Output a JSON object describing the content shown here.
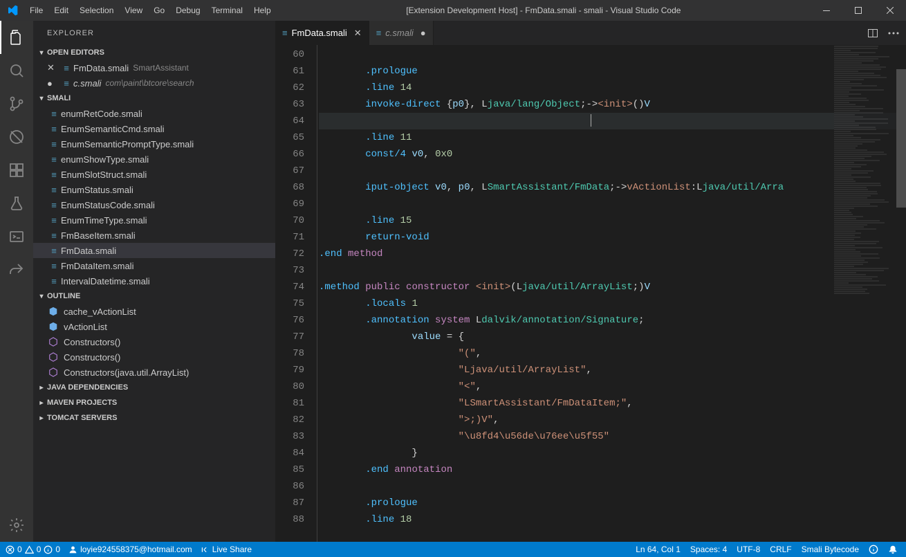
{
  "titlebar": {
    "menus": [
      "File",
      "Edit",
      "Selection",
      "View",
      "Go",
      "Debug",
      "Terminal",
      "Help"
    ],
    "title": "[Extension Development Host] - FmData.smali - smali - Visual Studio Code"
  },
  "sidebar": {
    "title": "EXPLORER",
    "sections": {
      "openEditors": {
        "label": "OPEN EDITORS",
        "items": [
          {
            "name": "FmData.smali",
            "desc": "SmartAssistant",
            "modified": false,
            "italic": false
          },
          {
            "name": "c.smali",
            "desc": "com\\paint\\btcore\\search",
            "modified": true,
            "italic": true
          }
        ]
      },
      "smali": {
        "label": "SMALI",
        "files": [
          "enumRetCode.smali",
          "EnumSemanticCmd.smali",
          "EnumSemanticPromptType.smali",
          "enumShowType.smali",
          "EnumSlotStruct.smali",
          "EnumStatus.smali",
          "EnumStatusCode.smali",
          "EnumTimeType.smali",
          "FmBaseItem.smali",
          "FmData.smali",
          "FmDataItem.smali",
          "IntervalDatetime.smali"
        ],
        "activeIndex": 9
      },
      "outline": {
        "label": "OUTLINE",
        "items": [
          {
            "icon": "cube",
            "label": "cache_vActionList"
          },
          {
            "icon": "cube",
            "label": "vActionList"
          },
          {
            "icon": "hex",
            "label": "Constructors()"
          },
          {
            "icon": "hex",
            "label": "Constructors()"
          },
          {
            "icon": "hex",
            "label": "Constructors(java.util.ArrayList)"
          }
        ]
      },
      "collapsed": [
        "JAVA DEPENDENCIES",
        "MAVEN PROJECTS",
        "TOMCAT SERVERS"
      ]
    }
  },
  "tabs": [
    {
      "name": "FmData.smali",
      "active": true,
      "dirty": false,
      "italic": false
    },
    {
      "name": "c.smali",
      "active": false,
      "dirty": true,
      "italic": true
    }
  ],
  "editor": {
    "lineStart": 60,
    "lineEnd": 88,
    "currentLine": 64,
    "lines": [
      {
        "n": 60,
        "indent": 0,
        "html": ""
      },
      {
        "n": 61,
        "indent": 2,
        "tokens": [
          [
            ".prologue",
            "dir"
          ]
        ]
      },
      {
        "n": 62,
        "indent": 2,
        "tokens": [
          [
            ".line",
            "dir"
          ],
          [
            " ",
            "plain"
          ],
          [
            "14",
            "num"
          ]
        ]
      },
      {
        "n": 63,
        "indent": 2,
        "tokens": [
          [
            "invoke-direct",
            "dir"
          ],
          [
            " {",
            "plain"
          ],
          [
            "p0",
            "id"
          ],
          [
            "}, L",
            "plain"
          ],
          [
            "java/lang/Object",
            "type"
          ],
          [
            ";->",
            "plain"
          ],
          [
            "<init>",
            "fn"
          ],
          [
            "()",
            "plain"
          ],
          [
            "V",
            "id"
          ]
        ]
      },
      {
        "n": 64,
        "indent": 0,
        "tokens": []
      },
      {
        "n": 65,
        "indent": 2,
        "tokens": [
          [
            ".line",
            "dir"
          ],
          [
            " ",
            "plain"
          ],
          [
            "11",
            "num"
          ]
        ]
      },
      {
        "n": 66,
        "indent": 2,
        "tokens": [
          [
            "const/4",
            "dir"
          ],
          [
            " ",
            "plain"
          ],
          [
            "v0",
            "id"
          ],
          [
            ", ",
            "plain"
          ],
          [
            "0x0",
            "num"
          ]
        ]
      },
      {
        "n": 67,
        "indent": 0,
        "tokens": []
      },
      {
        "n": 68,
        "indent": 2,
        "tokens": [
          [
            "iput-object",
            "dir"
          ],
          [
            " ",
            "plain"
          ],
          [
            "v0",
            "id"
          ],
          [
            ", ",
            "plain"
          ],
          [
            "p0",
            "id"
          ],
          [
            ", L",
            "plain"
          ],
          [
            "SmartAssistant/FmData",
            "type"
          ],
          [
            ";->",
            "plain"
          ],
          [
            "vActionList",
            "fn"
          ],
          [
            ":L",
            "plain"
          ],
          [
            "java/util/Arra",
            "type"
          ]
        ]
      },
      {
        "n": 69,
        "indent": 0,
        "tokens": []
      },
      {
        "n": 70,
        "indent": 2,
        "tokens": [
          [
            ".line",
            "dir"
          ],
          [
            " ",
            "plain"
          ],
          [
            "15",
            "num"
          ]
        ]
      },
      {
        "n": 71,
        "indent": 2,
        "tokens": [
          [
            "return-void",
            "dir"
          ]
        ]
      },
      {
        "n": 72,
        "indent": 0,
        "tokens": [
          [
            ".end",
            "dir"
          ],
          [
            " ",
            "plain"
          ],
          [
            "method",
            "kw"
          ]
        ]
      },
      {
        "n": 73,
        "indent": 0,
        "tokens": []
      },
      {
        "n": 74,
        "indent": 0,
        "tokens": [
          [
            ".method",
            "dir"
          ],
          [
            " ",
            "plain"
          ],
          [
            "public",
            "kw"
          ],
          [
            " ",
            "plain"
          ],
          [
            "constructor",
            "kw"
          ],
          [
            " ",
            "plain"
          ],
          [
            "<init>",
            "fn"
          ],
          [
            "(L",
            "plain"
          ],
          [
            "java/util/ArrayList",
            "type"
          ],
          [
            ";)",
            "plain"
          ],
          [
            "V",
            "id"
          ]
        ]
      },
      {
        "n": 75,
        "indent": 2,
        "tokens": [
          [
            ".locals",
            "dir"
          ],
          [
            " ",
            "plain"
          ],
          [
            "1",
            "num"
          ]
        ]
      },
      {
        "n": 76,
        "indent": 2,
        "tokens": [
          [
            ".annotation",
            "dir"
          ],
          [
            " ",
            "plain"
          ],
          [
            "system",
            "kw"
          ],
          [
            " L",
            "plain"
          ],
          [
            "dalvik/annotation/Signature",
            "type"
          ],
          [
            ";",
            "plain"
          ]
        ]
      },
      {
        "n": 77,
        "indent": 4,
        "tokens": [
          [
            "value",
            "id"
          ],
          [
            " = {",
            "plain"
          ]
        ]
      },
      {
        "n": 78,
        "indent": 6,
        "tokens": [
          [
            "\"(\"",
            "str"
          ],
          [
            ",",
            "plain"
          ]
        ]
      },
      {
        "n": 79,
        "indent": 6,
        "tokens": [
          [
            "\"Ljava/util/ArrayList\"",
            "str"
          ],
          [
            ",",
            "plain"
          ]
        ]
      },
      {
        "n": 80,
        "indent": 6,
        "tokens": [
          [
            "\"<\"",
            "str"
          ],
          [
            ",",
            "plain"
          ]
        ]
      },
      {
        "n": 81,
        "indent": 6,
        "tokens": [
          [
            "\"LSmartAssistant/FmDataItem;\"",
            "str"
          ],
          [
            ",",
            "plain"
          ]
        ]
      },
      {
        "n": 82,
        "indent": 6,
        "tokens": [
          [
            "\">;)V\"",
            "str"
          ],
          [
            ",",
            "plain"
          ]
        ]
      },
      {
        "n": 83,
        "indent": 6,
        "tokens": [
          [
            "\"\\u8fd4\\u56de\\u76ee\\u5f55\"",
            "str"
          ]
        ]
      },
      {
        "n": 84,
        "indent": 4,
        "tokens": [
          [
            "}",
            "plain"
          ]
        ]
      },
      {
        "n": 85,
        "indent": 2,
        "tokens": [
          [
            ".end",
            "dir"
          ],
          [
            " ",
            "plain"
          ],
          [
            "annotation",
            "kw"
          ]
        ]
      },
      {
        "n": 86,
        "indent": 0,
        "tokens": []
      },
      {
        "n": 87,
        "indent": 2,
        "tokens": [
          [
            ".prologue",
            "dir"
          ]
        ]
      },
      {
        "n": 88,
        "indent": 2,
        "tokens": [
          [
            ".line",
            "dir"
          ],
          [
            " ",
            "plain"
          ],
          [
            "18",
            "num"
          ]
        ]
      }
    ]
  },
  "statusbar": {
    "errors": "0",
    "warnings": "0",
    "infos": "0",
    "user": "loyie924558375@hotmail.com",
    "liveShare": "Live Share",
    "position": "Ln 64, Col 1",
    "spaces": "Spaces: 4",
    "encoding": "UTF-8",
    "eol": "CRLF",
    "language": "Smali Bytecode"
  }
}
